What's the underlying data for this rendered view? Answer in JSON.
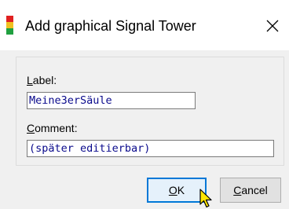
{
  "dialog": {
    "title": "Add graphical Signal Tower",
    "icon": "signal-tower-icon",
    "icon_colors": [
      "#e02020",
      "#f0c020",
      "#20a040"
    ]
  },
  "form": {
    "label_field": {
      "label_mnemonic": "L",
      "label_rest": "abel:",
      "value": "Meine3erSäule"
    },
    "comment_field": {
      "label_mnemonic": "C",
      "label_rest": "omment:",
      "value": "(später editierbar)"
    }
  },
  "buttons": {
    "ok": {
      "mnemonic": "O",
      "rest": "K"
    },
    "cancel": {
      "mnemonic": "C",
      "rest": "ancel"
    }
  },
  "colors": {
    "accent": "#0078d7",
    "field_text": "#0a0a8c"
  }
}
